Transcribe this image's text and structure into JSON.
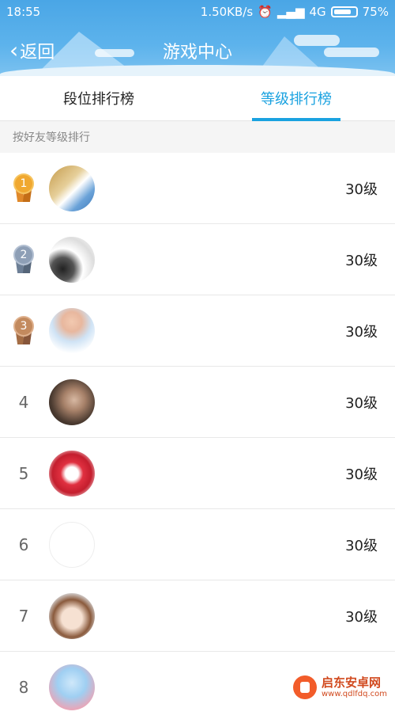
{
  "status_bar": {
    "time": "18:55",
    "speed": "1.50KB/s",
    "network": "4G",
    "battery": "75%"
  },
  "header": {
    "back_label": "返回",
    "title": "游戏中心"
  },
  "tabs": [
    {
      "label": "段位排行榜",
      "active": false
    },
    {
      "label": "等级排行榜",
      "active": true
    }
  ],
  "section_label": "按好友等级排行",
  "accent_color": "#1aa2e0",
  "rows": [
    {
      "rank": "1",
      "name": "",
      "level": "30级",
      "medal": "gold"
    },
    {
      "rank": "2",
      "name": "",
      "level": "30级",
      "medal": "silver"
    },
    {
      "rank": "3",
      "name": "",
      "level": "30级",
      "medal": "bronze"
    },
    {
      "rank": "4",
      "name": "",
      "level": "30级"
    },
    {
      "rank": "5",
      "name": "",
      "level": "30级"
    },
    {
      "rank": "6",
      "name": "",
      "level": "30级"
    },
    {
      "rank": "7",
      "name": "",
      "level": "30级"
    },
    {
      "rank": "8",
      "name": "",
      "level": ""
    }
  ],
  "watermark": {
    "title": "启东安卓网",
    "url": "www.qdlfdq.com"
  }
}
